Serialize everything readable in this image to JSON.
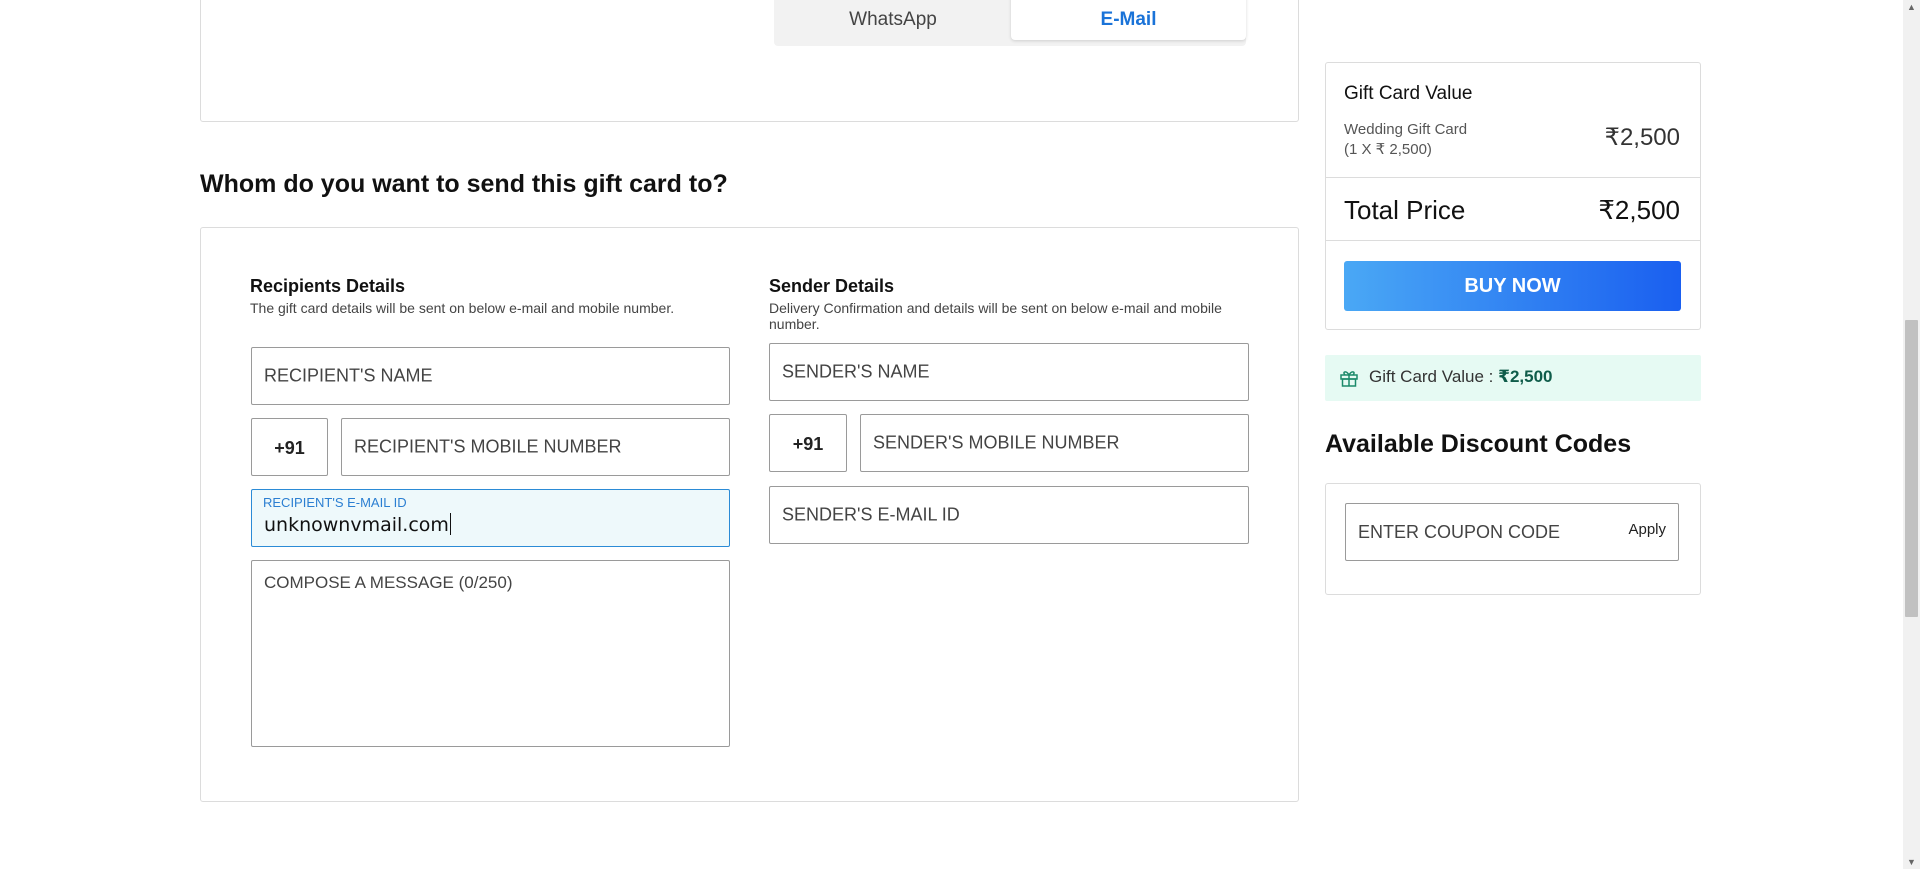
{
  "delivery_channels": {
    "whatsapp": "WhatsApp",
    "email": "E-Mail",
    "selected": "E-Mail"
  },
  "section_title": "Whom do you want to send this gift card to?",
  "recipient": {
    "heading": "Recipients Details",
    "subtext": "The gift card details will be sent on below e-mail and mobile number.",
    "name_placeholder": "RECIPIENT'S NAME",
    "country_code": "+91",
    "mobile_placeholder": "RECIPIENT'S MOBILE NUMBER",
    "email_label": "RECIPIENT'S E-MAIL ID",
    "email_value": "unknownvmail.com",
    "message_placeholder": "COMPOSE A MESSAGE (0/250)"
  },
  "sender": {
    "heading": "Sender Details",
    "subtext": "Delivery Confirmation and details will be sent on below e-mail and mobile number.",
    "name_placeholder": "SENDER'S NAME",
    "country_code": "+91",
    "mobile_placeholder": "SENDER'S MOBILE NUMBER",
    "email_placeholder": "SENDER'S E-MAIL ID"
  },
  "summary": {
    "title": "Gift Card Value",
    "item_name": "Wedding Gift Card",
    "item_qty": "(1 X ₹ 2,500)",
    "item_price": "₹2,500",
    "total_label": "Total Price",
    "total_value": "₹2,500",
    "buy_label": "BUY NOW"
  },
  "gift_banner": {
    "label": "Gift Card Value : ",
    "value": "₹2,500",
    "icon": "gift-icon",
    "bg_color": "#e6faf3"
  },
  "discounts": {
    "title": "Available Discount Codes",
    "coupon_placeholder": "ENTER COUPON CODE",
    "apply_label": "Apply"
  },
  "colors": {
    "accent": "#1a73d8",
    "buy_gradient_start": "#4aa8f5",
    "buy_gradient_end": "#1a5ff0"
  }
}
